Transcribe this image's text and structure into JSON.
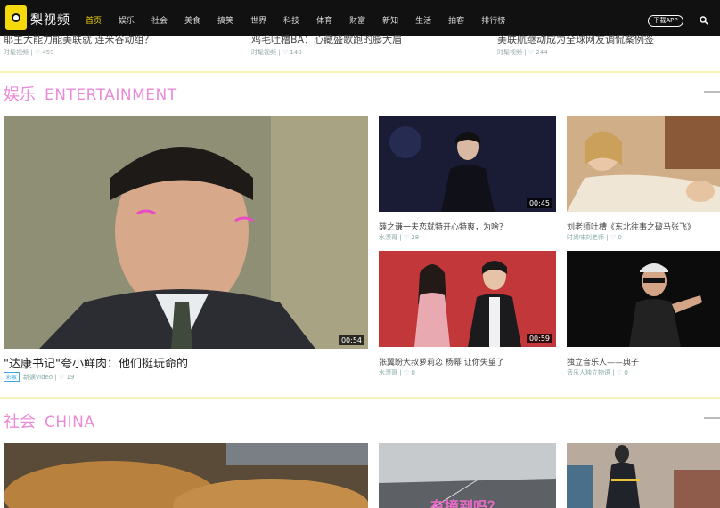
{
  "brand": {
    "name": "梨视频"
  },
  "nav": {
    "items": [
      "首页",
      "娱乐",
      "社会",
      "美食",
      "搞笑",
      "世界",
      "科技",
      "体育",
      "财富",
      "新知",
      "生活",
      "拍客",
      "排行榜"
    ],
    "active_index": 0,
    "download_label": "下载APP"
  },
  "prev_row": [
    {
      "title": "耶主大能力能美联就 连米谷动组？",
      "source": "时髦视频",
      "likes": "459"
    },
    {
      "title": "鸡毛吐槽BA：心藏盛歌跑的膨大眉",
      "source": "时髦视频",
      "likes": "148"
    },
    {
      "title": "美联航继动成为全球网友调侃案例签",
      "source": "时髦视频",
      "likes": "244"
    }
  ],
  "sections": [
    {
      "cn": "娱乐",
      "en": "ENTERTAINMENT"
    },
    {
      "cn": "社会",
      "en": "CHINA"
    }
  ],
  "featured": {
    "title": "\"达康书记\"夸小鲜肉：他们挺玩命的",
    "tag": "彩蛋",
    "source": "新娱video",
    "likes": "19",
    "duration": "00:54"
  },
  "cards": [
    {
      "title": "薛之谦一夫恋就特开心特爽，为啥？",
      "source": "水漂哥",
      "likes": "28",
      "duration": "00:45"
    },
    {
      "title": "刘老师吐槽《东北往事之破马张飞》",
      "source": "时尚味刘老师",
      "likes": "0",
      "duration": ""
    },
    {
      "title": "张翼盼大叔萝莉恋 杨幂 让你失望了",
      "source": "水漂哥",
      "likes": "0",
      "duration": "00:59"
    },
    {
      "title": "独立音乐人——典子",
      "source": "音乐人独立物语",
      "likes": "0",
      "duration": ""
    }
  ],
  "china_teaser": {
    "overlay_text": "有撞到吗？"
  },
  "colors": {
    "accent": "#f5d90a",
    "section": "#e98bd7",
    "tag": "#3aa6e6"
  }
}
